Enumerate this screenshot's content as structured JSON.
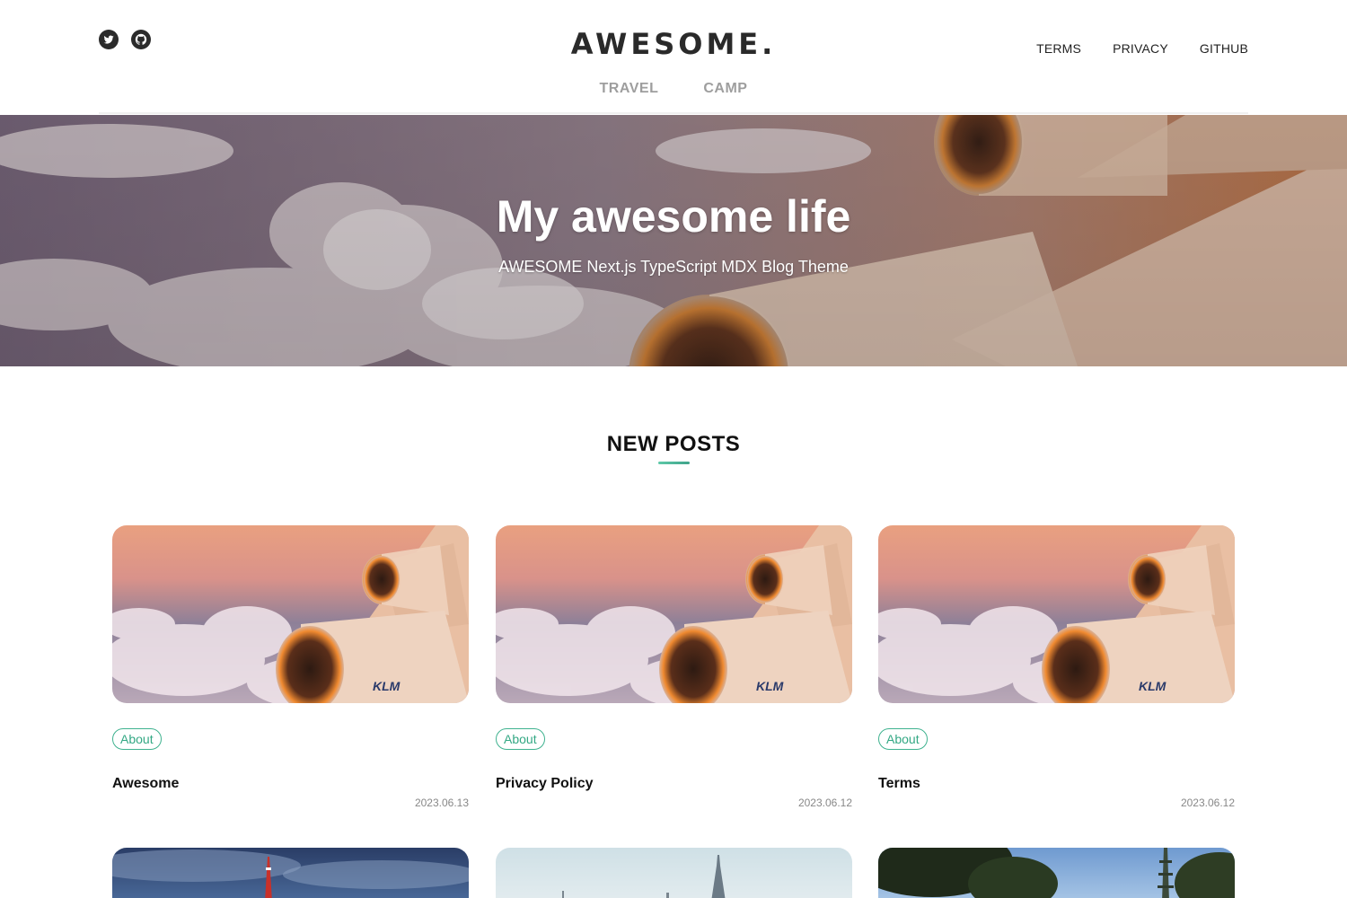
{
  "header": {
    "logo": "AWESOME.",
    "social": [
      {
        "icon": "twitter-icon"
      },
      {
        "icon": "github-icon"
      }
    ],
    "top_nav": [
      "TERMS",
      "PRIVACY",
      "GITHUB"
    ],
    "categories": [
      "TRAVEL",
      "CAMP"
    ]
  },
  "hero": {
    "title": "My awesome life",
    "subtitle": "AWESOME Next.js TypeScript MDX Blog Theme"
  },
  "section": {
    "title": "NEW POSTS"
  },
  "posts": [
    {
      "tag": "About",
      "title": "Awesome",
      "date": "2023.06.13"
    },
    {
      "tag": "About",
      "title": "Privacy Policy",
      "date": "2023.06.12"
    },
    {
      "tag": "About",
      "title": "Terms",
      "date": "2023.06.12"
    }
  ],
  "colors": {
    "accent": "#3fb28f",
    "nav_muted": "#9e9e9e",
    "text": "#111111"
  }
}
